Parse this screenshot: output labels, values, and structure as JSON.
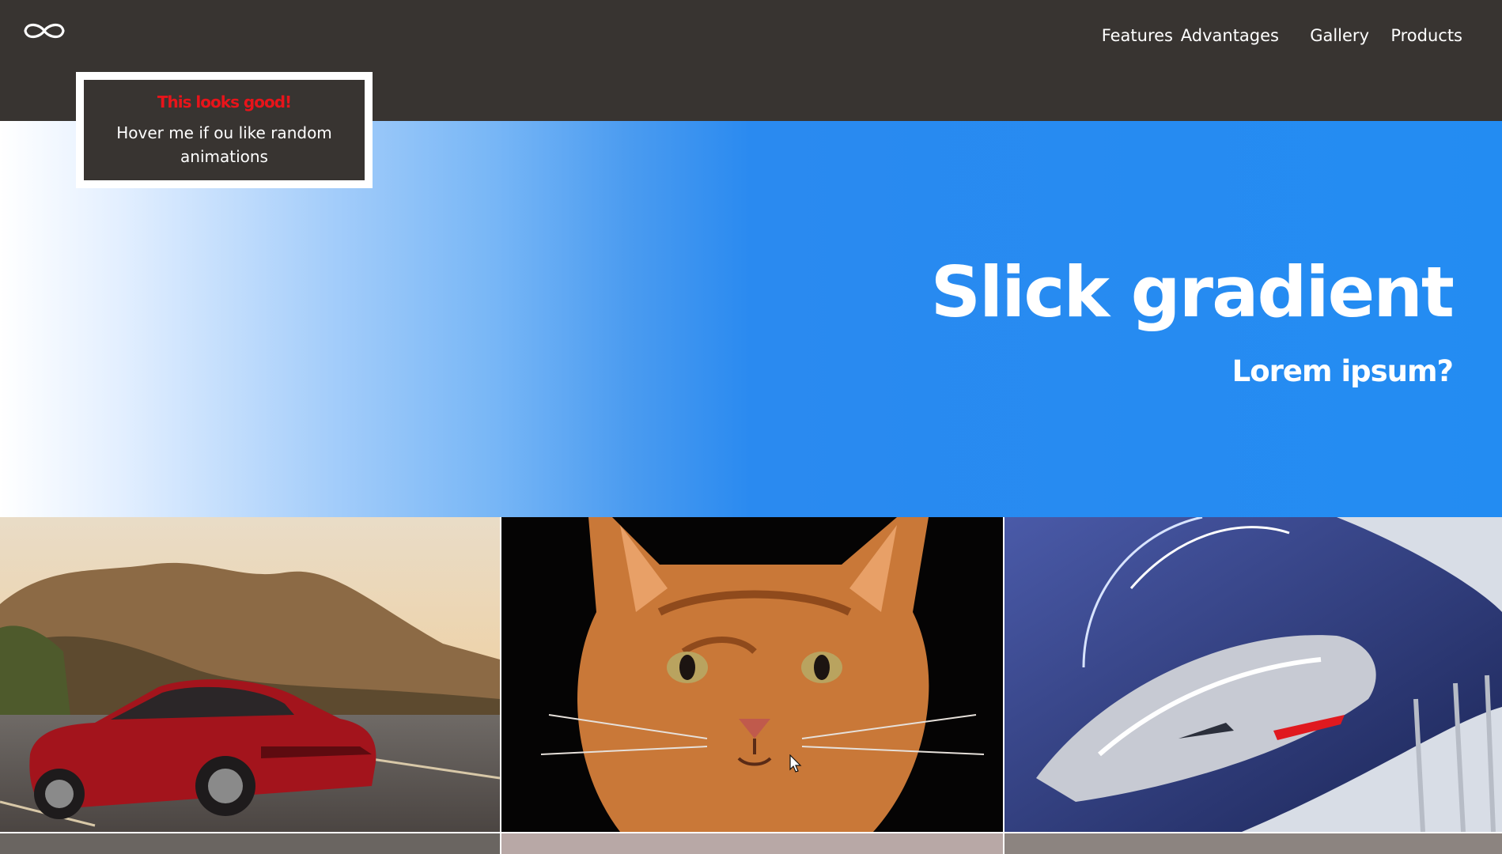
{
  "header": {
    "logo_icon": "infinity-icon",
    "nav": [
      {
        "label": "Features"
      },
      {
        "label": "Advantages"
      },
      {
        "label": "Gallery"
      },
      {
        "label": "Products"
      }
    ],
    "background_color": "#383431"
  },
  "tooltip": {
    "title": "This looks good!",
    "body": "Hover me if ou like random animations",
    "title_color": "#e8141a"
  },
  "hero": {
    "title": "Slick gradient",
    "subtitle": "Lorem ipsum?",
    "gradient_from": "#ffffff",
    "gradient_to": "#238cf2"
  },
  "gallery": {
    "images": [
      {
        "icon": "red-car-on-road-image"
      },
      {
        "icon": "orange-cat-portrait-image"
      },
      {
        "icon": "hyperloop-train-image"
      }
    ]
  }
}
